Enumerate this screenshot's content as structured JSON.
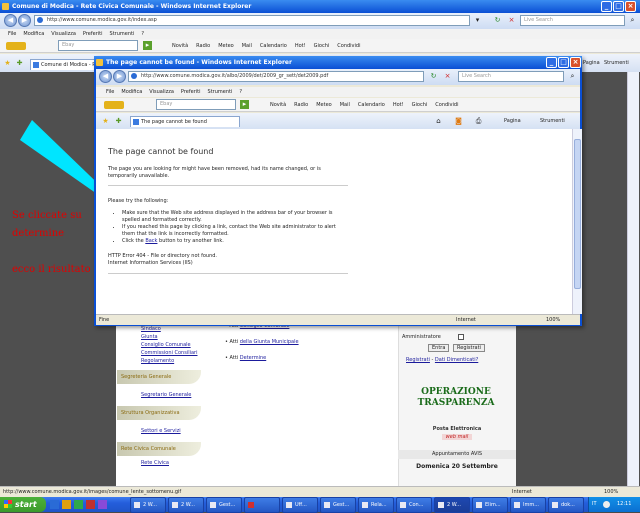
{
  "outer": {
    "title": "Comune di Modica - Rete Civica Comunale - Windows Internet Explorer",
    "address": "http://www.comune.modica.gov.it/index.asp",
    "search_placeholder": "Live Search",
    "menu": [
      "File",
      "Modifica",
      "Visualizza",
      "Preferiti",
      "Strumenti",
      "?"
    ],
    "toolbar_search": "Ebay",
    "toolbar_items": [
      "Novità",
      "Radio",
      "Meteo",
      "Mail",
      "Calendario",
      "Hot!",
      "Giochi",
      "Condividi"
    ],
    "tab_label": "Comune di Modica - R...",
    "tab_close": "×",
    "right_tools": [
      "Pagina",
      "Strumenti"
    ],
    "status_url": "http://www.comune.modica.gov.it/images/comune_lente_sottomenu.gif",
    "status_zone": "Internet",
    "status_zoom": "100%"
  },
  "popup": {
    "title": "The page cannot be found - Windows Internet Explorer",
    "address": "http://www.comune.modica.gov.it/albo/2009/det/2009_gr_sett/det2009.pdf",
    "search_placeholder": "Live Search",
    "menu": [
      "File",
      "Modifica",
      "Visualizza",
      "Preferiti",
      "Strumenti",
      "?"
    ],
    "toolbar_search": "Ebay",
    "toolbar_items": [
      "Novità",
      "Radio",
      "Meteo",
      "Mail",
      "Calendario",
      "Hot!",
      "Giochi",
      "Condividi"
    ],
    "tab_label": "The page cannot be found",
    "right_tools": [
      "Pagina",
      "Strumenti"
    ],
    "error_title": "The page cannot be found",
    "error_desc": "The page you are looking for might have been removed, had its name changed, or is temporarily unavailable.",
    "try_heading": "Please try the following:",
    "bullet1": "Make sure that the Web site address displayed in the address bar of your browser is spelled and formatted correctly.",
    "bullet2": "If you reached this page by clicking a link, contact the Web site administrator to alert them that the link is incorrectly formatted.",
    "bullet3_pre": "Click the",
    "bullet3_link": "Back",
    "bullet3_post": "button to try another link.",
    "http_error": "HTTP Error 404 - File or directory not found.",
    "iis": "Internet Information Services (IIS)",
    "status_left": "Fine",
    "status_zone": "Internet",
    "status_zoom": "100%"
  },
  "annotation": {
    "line1": "Se cliccate su",
    "line2": "determine",
    "line3": "ecco il risultato"
  },
  "site": {
    "sidebar_links_top": [
      "Sindaco",
      "Giunta",
      "Consiglio Comunale",
      "Commissioni Consiliari",
      "Regolamento"
    ],
    "sections": [
      {
        "title": "Segreteria Generale",
        "links": [
          "Segretario Generale"
        ]
      },
      {
        "title": "Struttura Organizzativa",
        "links": [
          "Settori e Servizi"
        ]
      },
      {
        "title": "Rete Civica Comunale",
        "links": [
          "Rete Civica"
        ]
      }
    ],
    "albo_items": [
      {
        "pre": "Atti",
        "link": "Consiglio Comunale"
      },
      {
        "pre": "Atti",
        "link": "della Giunta Municipale"
      },
      {
        "pre": "Atti",
        "link": "Determine"
      }
    ],
    "admin_label": "Amministratore",
    "login_buttons": [
      "Entra",
      "Registrati"
    ],
    "register_text": "Registrati",
    "lost_password": "Dati Dimenticati?",
    "op_line1": "OPERAZIONE",
    "op_line2": "TRASPARENZA",
    "posta": "Posta Elettronica",
    "posta_badge": "web mail",
    "appointments": "Appuntamento AVIS",
    "date": "Domenica 20 Settembre"
  },
  "taskbar": {
    "start": "start",
    "tasks": [
      "2 W...",
      "2 W...",
      "Gest...",
      "",
      "Uff...",
      "Gest...",
      "Rela...",
      "Con...",
      "2 W...",
      "Elim...",
      "Imm...",
      "dok..."
    ],
    "lang": "IT",
    "clock": "12:11"
  },
  "colors": {
    "titlebar": "#0a4fd4",
    "taskbar": "#245edb",
    "start": "#3c9a2c",
    "annotation_red": "#e00000",
    "arrow": "#00e5ff",
    "site_green": "#1a6b1a"
  }
}
